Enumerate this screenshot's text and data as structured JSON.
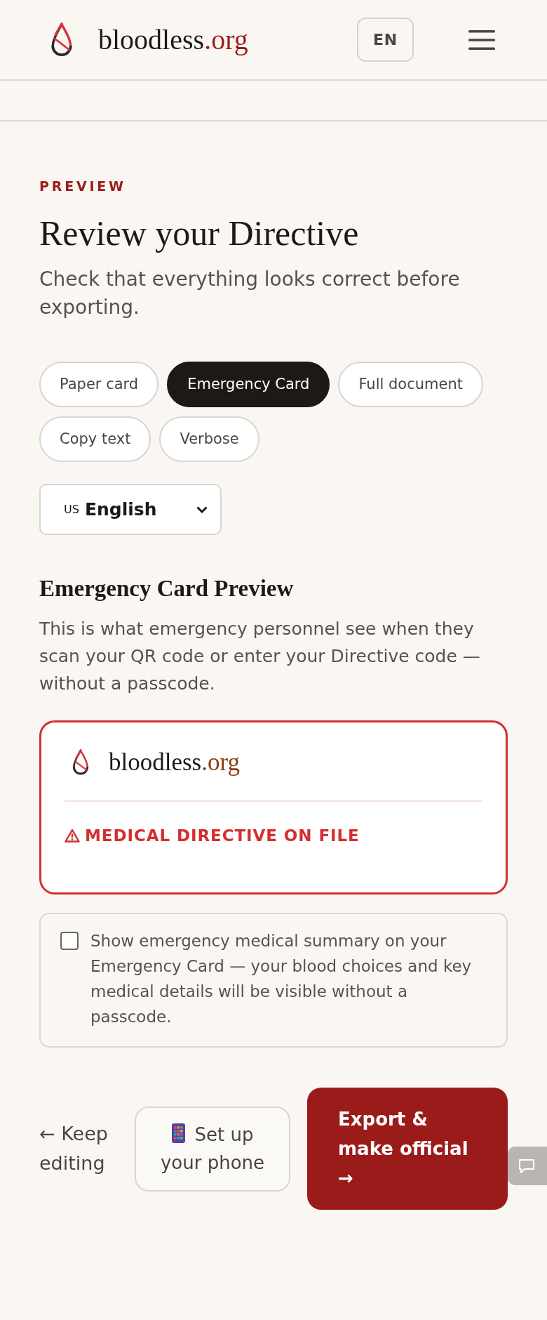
{
  "header": {
    "logo_text": "bloodless",
    "logo_tld": ".org",
    "language_button": "EN"
  },
  "eyebrow": "PREVIEW",
  "title": "Review your Directive",
  "subtitle": "Check that everything looks correct before exporting.",
  "view_options": [
    {
      "label": "Paper card",
      "selected": false
    },
    {
      "label": "Emergency Card",
      "selected": true
    },
    {
      "label": "Full document",
      "selected": false
    },
    {
      "label": "Copy text",
      "selected": false
    },
    {
      "label": "Verbose",
      "selected": false
    }
  ],
  "language_select": {
    "flag": "US",
    "value": "English"
  },
  "section": {
    "title": "Emergency Card Preview",
    "description": "This is what emergency personnel see when they scan your QR code or enter your Directive code — without a passcode."
  },
  "emergency_card": {
    "logo_text": "bloodless",
    "logo_tld": ".org",
    "alert": "MEDICAL DIRECTIVE ON FILE"
  },
  "summary_option": {
    "label": "Show emergency medical summary on your Emergency Card — your blood choices and key medical details will be visible without a passcode.",
    "checked": false
  },
  "actions": [
    {
      "kind": "link",
      "label": "← Keep editing"
    },
    {
      "kind": "secondary",
      "label": "Set up your phone"
    },
    {
      "kind": "primary",
      "label": "Export & make official →"
    }
  ]
}
